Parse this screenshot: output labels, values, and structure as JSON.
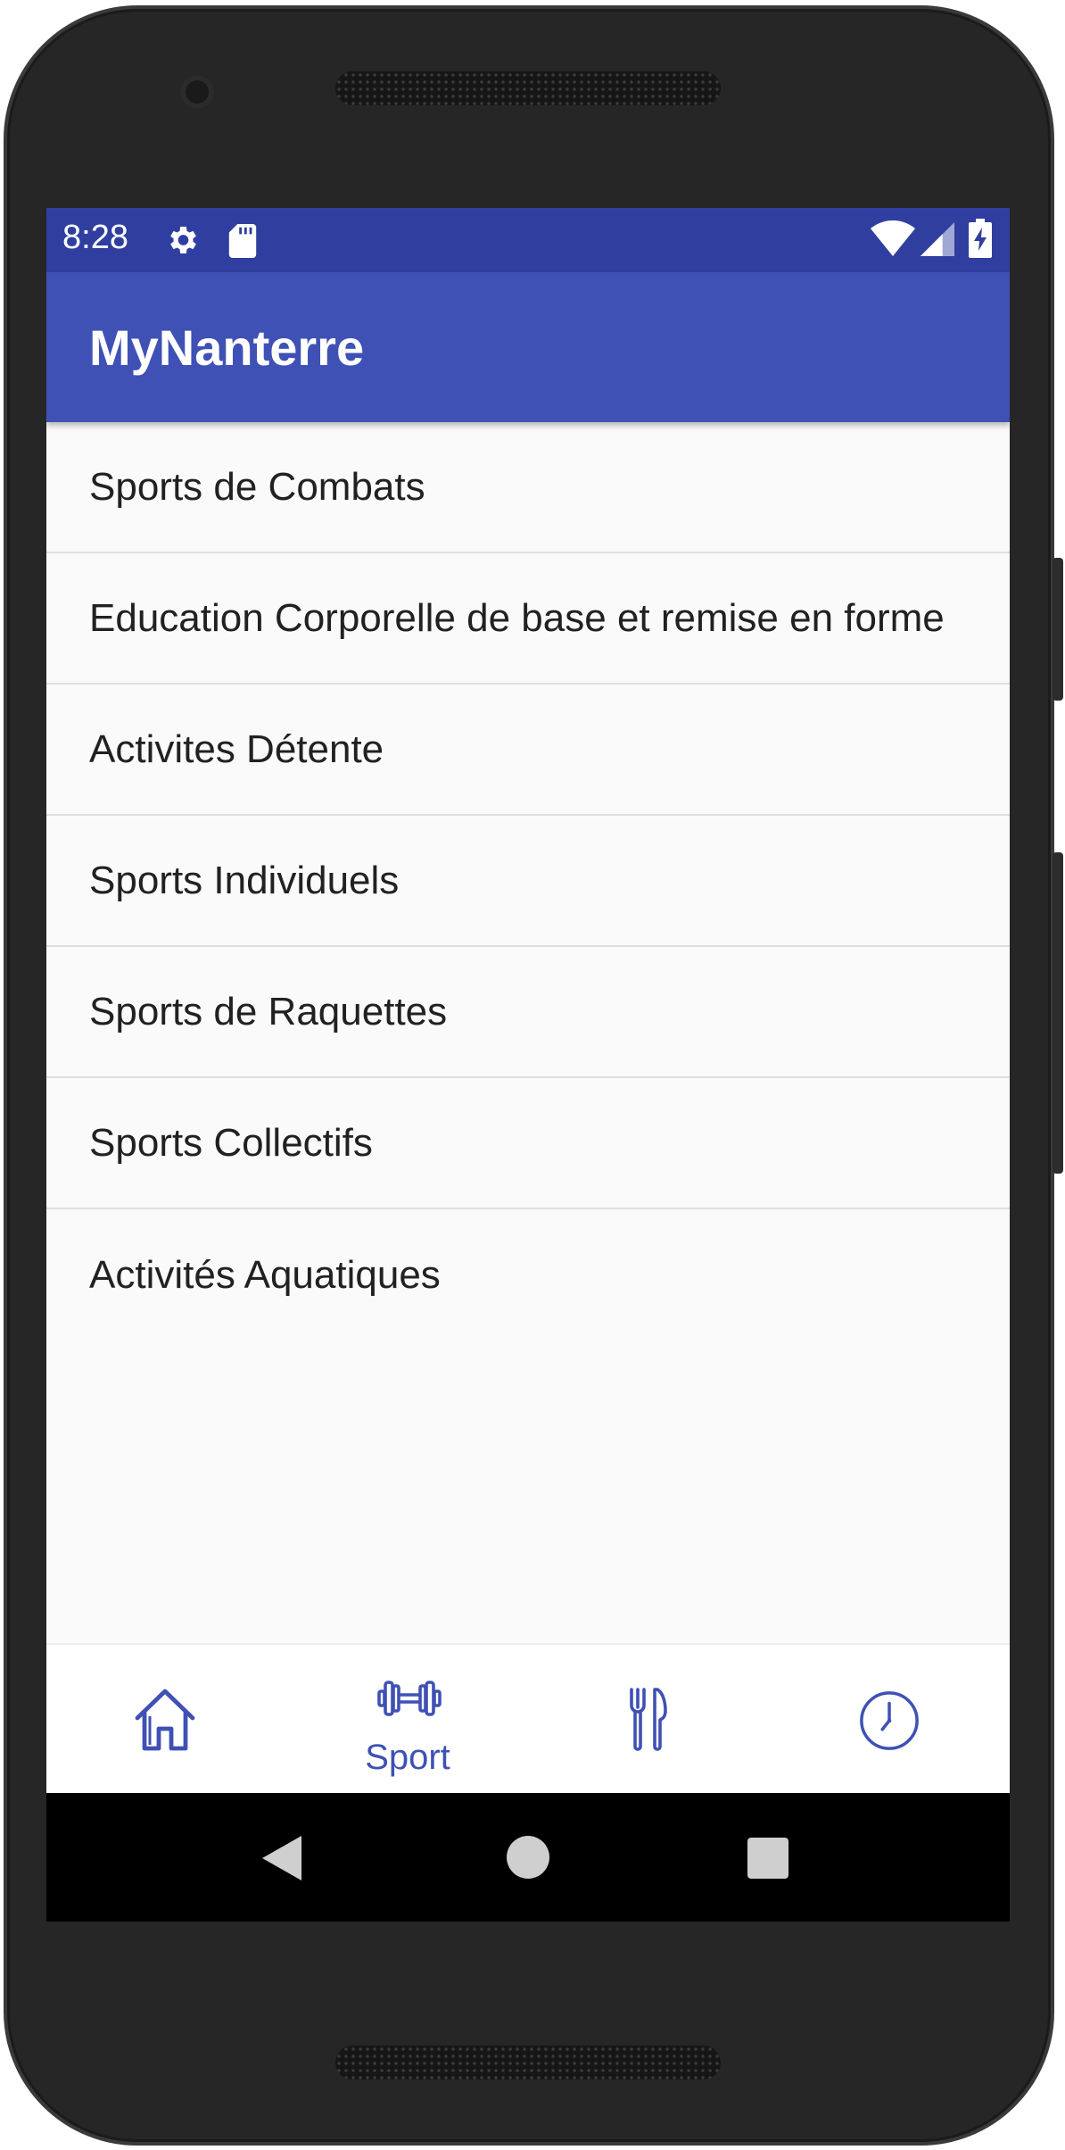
{
  "status_bar": {
    "time": "8:28",
    "icons": [
      "gear-icon",
      "sd-card-icon",
      "wifi-icon",
      "signal-icon",
      "battery-charging-icon"
    ]
  },
  "app_bar": {
    "title": "MyNanterre"
  },
  "categories": [
    {
      "label": "Sports de Combats"
    },
    {
      "label": "Education Corporelle de base et remise en forme"
    },
    {
      "label": "Activites Détente"
    },
    {
      "label": "Sports Individuels"
    },
    {
      "label": "Sports de Raquettes"
    },
    {
      "label": "Sports Collectifs"
    },
    {
      "label": "Activités Aquatiques"
    }
  ],
  "bottom_nav": {
    "items": [
      {
        "icon": "home-icon",
        "label": "",
        "selected": false
      },
      {
        "icon": "dumbbell-icon",
        "label": "Sport",
        "selected": true
      },
      {
        "icon": "restaurant-icon",
        "label": "",
        "selected": false
      },
      {
        "icon": "clock-icon",
        "label": "",
        "selected": false
      }
    ]
  },
  "system_nav": {
    "icons": [
      "back-icon",
      "home-circle-icon",
      "recents-icon"
    ]
  },
  "colors": {
    "status_bar": "#303f9f",
    "app_bar": "#3f51b5",
    "accent": "#3f51b5",
    "list_background": "#fafafa"
  }
}
